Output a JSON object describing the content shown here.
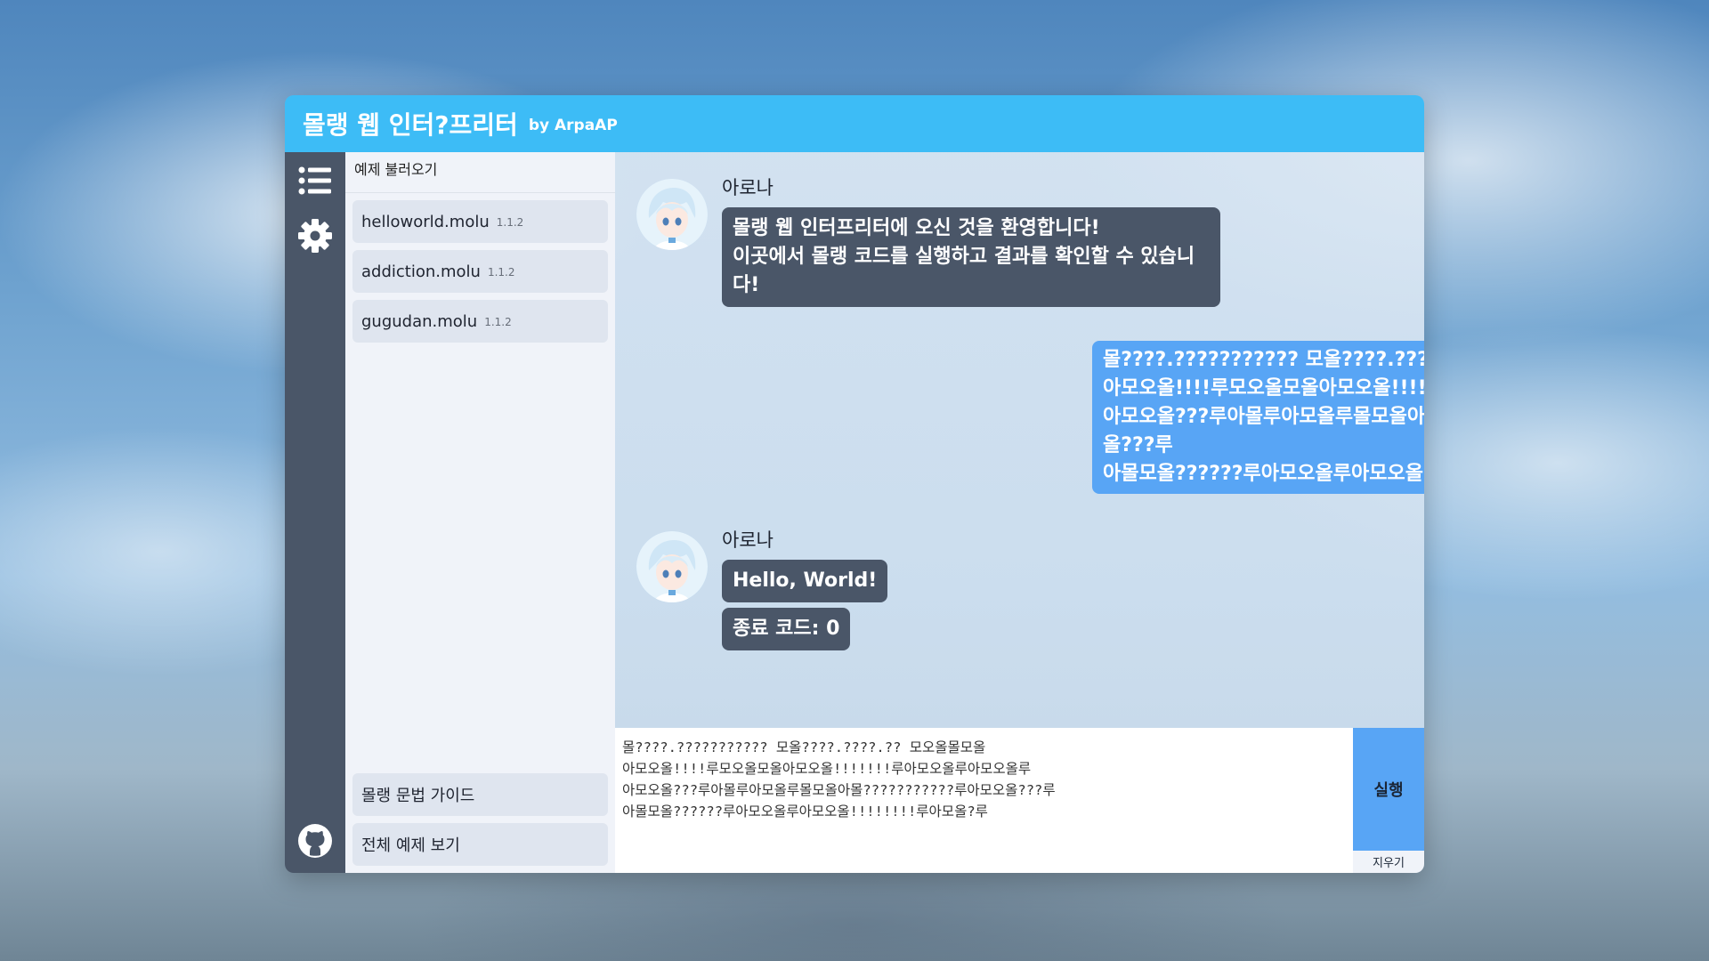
{
  "header": {
    "title": "몰랭 웹 인터?프리터",
    "by": "by ArpaAP"
  },
  "rail": {
    "icons": [
      "list-icon",
      "gear-icon",
      "github-icon"
    ]
  },
  "examples": {
    "header": "예제 불러오기",
    "items": [
      {
        "name": "helloworld.molu",
        "version": "1.1.2"
      },
      {
        "name": "addiction.molu",
        "version": "1.1.2"
      },
      {
        "name": "gugudan.molu",
        "version": "1.1.2"
      }
    ],
    "guide_label": "몰랭 문법 가이드",
    "all_label": "전체 예제 보기"
  },
  "chat": {
    "bot_name": "아로나",
    "welcome_lines": [
      "몰랭 웹 인터프리터에 오신 것을 환영합니다!",
      "이곳에서 몰랭 코드를 실행하고 결과를 확인할 수 있습니",
      "다!"
    ],
    "user_lines": [
      "몰????.??????????? 모올????.????.?? 모오올몰모올",
      "아모오올!!!!루모오올모올아모오올!!!!!!!루아모오올루아모오올루",
      "아모오올???루아몰루아모올루몰모올아몰???????????루아모오",
      "올???루",
      "아몰모올??????루아모오올루아모오올!!!!!!!!루아모올?루"
    ],
    "output": "Hello, World!",
    "exit_code": "종료 코드: 0"
  },
  "editor": {
    "code_lines": [
      "몰????.??????????? 모올????.????.?? 모오올몰모올",
      "아모오올!!!!루모오올모올아모오올!!!!!!!루아모오올루아모오올루",
      "아모오올???루아몰루아모올루몰모올아몰???????????루아모오올???루",
      "아몰모올??????루아모오올루아모오올!!!!!!!!루아모올?루"
    ],
    "run_label": "실행",
    "clear_label": "지우기"
  },
  "colors": {
    "accent": "#3dbcf6",
    "rail": "#4a5668",
    "bubble_user": "#58a5f5",
    "bubble_bot": "#4a5668"
  }
}
